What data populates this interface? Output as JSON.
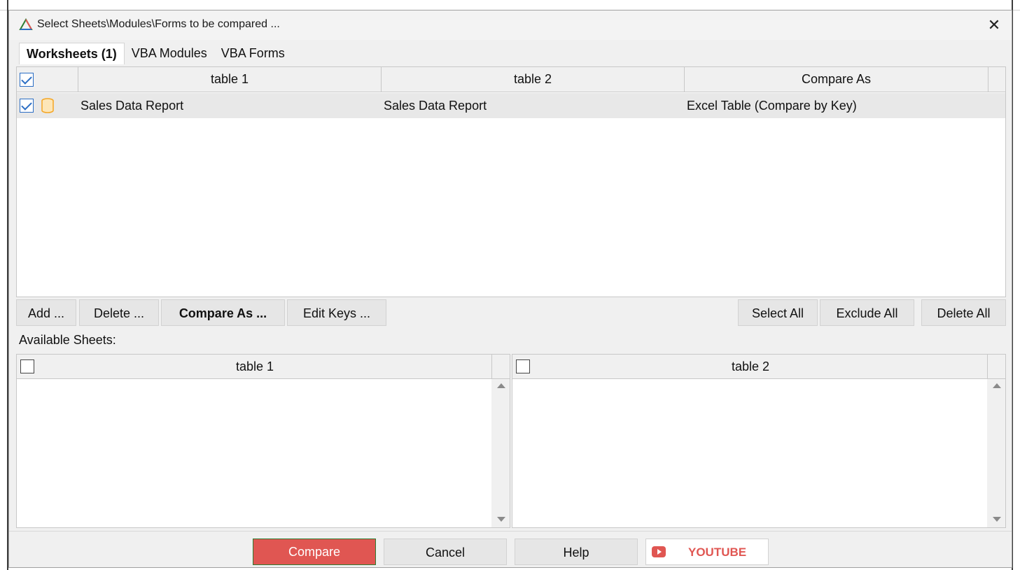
{
  "dialog": {
    "title": "Select Sheets\\Modules\\Forms to be compared ...",
    "close_symbol": "✕"
  },
  "tabs": [
    {
      "label": "Worksheets (1)",
      "active": true
    },
    {
      "label": "VBA Modules",
      "active": false
    },
    {
      "label": "VBA Forms",
      "active": false
    }
  ],
  "grid": {
    "columns": [
      "table 1",
      "table 2",
      "Compare As"
    ],
    "header_checked": true,
    "rows": [
      {
        "checked": true,
        "icon": "database-icon",
        "table1": "Sales Data Report",
        "table2": "Sales Data Report",
        "compare_as": "Excel Table (Compare by Key)"
      }
    ]
  },
  "actions": {
    "add": "Add ...",
    "delete": "Delete ...",
    "compare_as": "Compare As ...",
    "edit_keys": "Edit Keys ...",
    "select_all": "Select All",
    "exclude_all": "Exclude All",
    "delete_all": "Delete All"
  },
  "available": {
    "label": "Available Sheets:",
    "left_title": "table 1",
    "right_title": "table 2"
  },
  "footer": {
    "compare": "Compare",
    "cancel": "Cancel",
    "help": "Help",
    "youtube": "YOUTUBE"
  },
  "colors": {
    "compare_bg": "#e05652",
    "youtube_text": "#e05652",
    "check_blue": "#2b6ec4",
    "db_icon": "#f5a623"
  }
}
